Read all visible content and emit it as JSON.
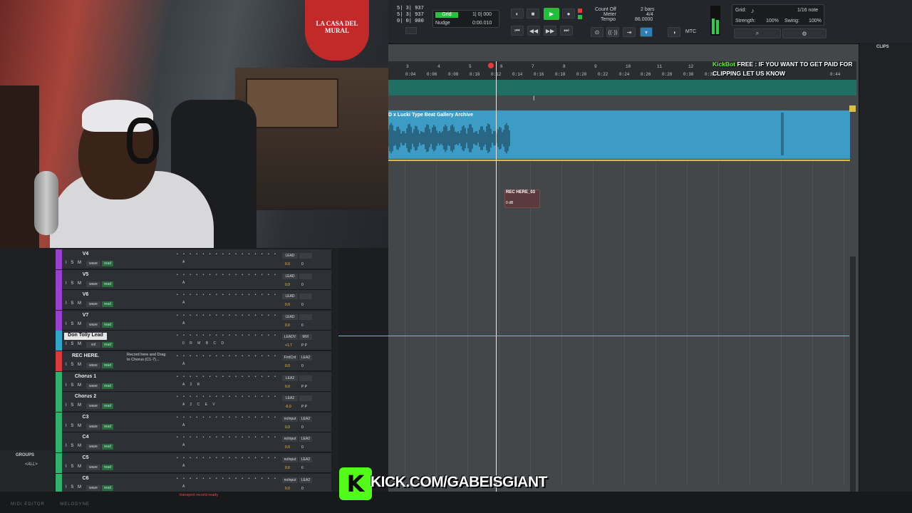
{
  "transport": {
    "counters": [
      "5| 3| 937",
      "5| 3| 937",
      "0| 0| 000"
    ],
    "grid_label": "Grid",
    "grid_value": "1| 0| 000",
    "nudge_label": "Nudge",
    "nudge_value": "0:00.010",
    "count_off": "Count Off",
    "meter": "Meter",
    "tempo": "Tempo",
    "bars": "2 bars",
    "meter_value": "4/4",
    "tempo_value": "86.0000",
    "grid_right_label": "Grid:",
    "grid_note": "1/16 note",
    "strength_label": "Strength:",
    "strength_value": "100%",
    "swing_label": "Swing:",
    "swing_value": "100%",
    "mtc": "MTC"
  },
  "ruler": {
    "bars": [
      "3",
      "4",
      "5",
      "6",
      "7",
      "8",
      "9",
      "10",
      "11",
      "12"
    ],
    "times": [
      "0:04",
      "0:06",
      "0:08",
      "0:10",
      "0:12",
      "0:14",
      "0:16",
      "0:18",
      "0:20",
      "0:22",
      "0:24",
      "0:26",
      "0:28",
      "0:30",
      "0:32",
      "0:44"
    ]
  },
  "clip": {
    "name": "D x Lucki Type Beat Gallery Archive",
    "rec_name": "REC HERE_03",
    "rec_db": "0 dB"
  },
  "tracks": [
    {
      "name": "V4",
      "color": "#9b3fd1",
      "io1": "LEAD",
      "io2": "",
      "vol": "0.0",
      "pan": "0",
      "ins": "A"
    },
    {
      "name": "V5",
      "color": "#9b3fd1",
      "io1": "LEAD",
      "io2": "",
      "vol": "0.0",
      "pan": "0",
      "ins": "A"
    },
    {
      "name": "V6",
      "color": "#9b3fd1",
      "io1": "LEAD",
      "io2": "",
      "vol": "0.0",
      "pan": "0",
      "ins": "A"
    },
    {
      "name": "V7",
      "color": "#9b3fd1",
      "io1": "LEAD",
      "io2": "",
      "vol": "0.0",
      "pan": "0",
      "ins": "A"
    },
    {
      "name": "Don Tolly Lead",
      "color": "#2fa6c9",
      "io1": "LEADV",
      "io2": "MIX",
      "vol": "+1.7",
      "pan": "P P",
      "ins": "0 R M B C D",
      "highlight": true
    },
    {
      "name": "REC HERE.",
      "color": "#d93a3a",
      "io1": "FrntCnt",
      "io2": "LEA2",
      "vol": "0.0",
      "pan": "0",
      "ins": "A",
      "note": "Record here and Drag to Chorus (C1-7)..."
    },
    {
      "name": "Chorus 1",
      "color": "#2fb36a",
      "io1": "LEA2",
      "io2": "",
      "vol": "0.0",
      "pan": "P P",
      "ins": "A 2 R"
    },
    {
      "name": "Chorus 2",
      "color": "#2fb36a",
      "io1": "LEA2",
      "io2": "",
      "vol": "-6.0",
      "pan": "P P",
      "ins": "A 2 C E  V"
    },
    {
      "name": "C3",
      "color": "#2fb36a",
      "io1": "noInput",
      "io2": "LEA2",
      "vol": "0.0",
      "pan": "0",
      "ins": "A"
    },
    {
      "name": "C4",
      "color": "#2fb36a",
      "io1": "noInput",
      "io2": "LEA2",
      "vol": "0.0",
      "pan": "0",
      "ins": "A"
    },
    {
      "name": "C5",
      "color": "#2fb36a",
      "io1": "noInput",
      "io2": "LEA2",
      "vol": "0.0",
      "pan": "0",
      "ins": "A"
    },
    {
      "name": "C6",
      "color": "#2fb36a",
      "io1": "noInput",
      "io2": "LEA2",
      "vol": "0.0",
      "pan": "0",
      "ins": "A"
    }
  ],
  "track_labels": {
    "ism": "I S M",
    "wave": "wave",
    "read": "read",
    "vol": "vol"
  },
  "groups": {
    "title": "GROUPS",
    "all": "<ALL>"
  },
  "clips_panel": {
    "title": "CLIPS"
  },
  "bottom": {
    "tabs": "MIDI EDITOR        MELODYNE",
    "status": "transport record ready"
  },
  "overlay": {
    "bot_name": "KickBot",
    "bot_message_1": "FREE : IF YOU WANT TO GET PAID FOR",
    "bot_message_2": "CLIPPING LET US KNOW",
    "badge_letter": "K",
    "url": "KICK.COM/GABEISGIANT"
  },
  "webcam": {
    "cap_text": "LA CASA DEL MURAL"
  }
}
